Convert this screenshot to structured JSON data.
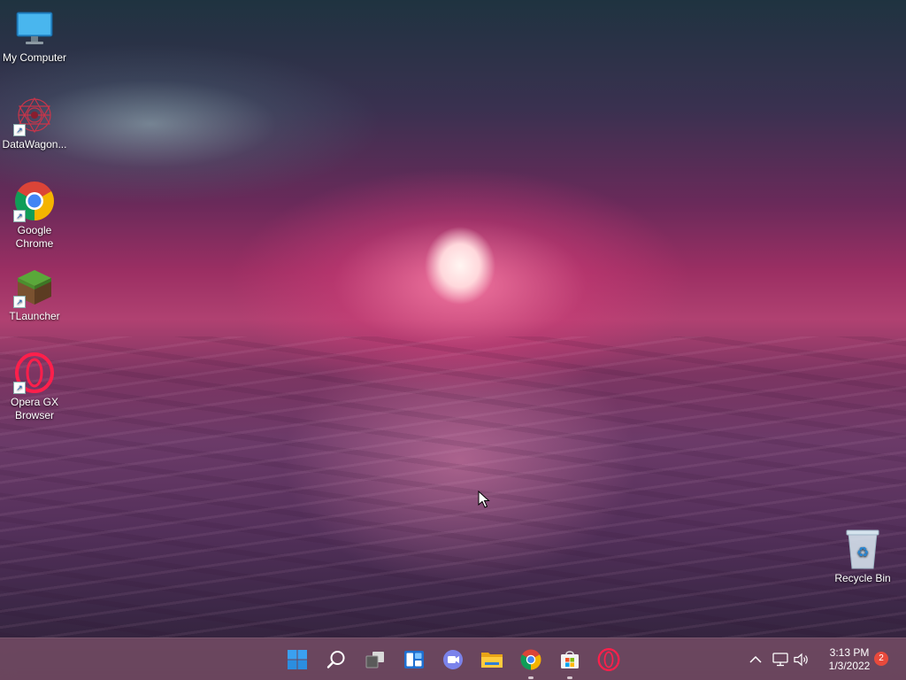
{
  "desktop_icons": [
    {
      "label": "My Computer",
      "icon": "monitor-icon",
      "shortcut": false
    },
    {
      "label": "DataWagon...",
      "icon": "datawagon-icon",
      "shortcut": true
    },
    {
      "label": "Google Chrome",
      "icon": "chrome-icon",
      "shortcut": true
    },
    {
      "label": "TLauncher",
      "icon": "grass-block-icon",
      "shortcut": true
    },
    {
      "label": "Opera GX Browser",
      "icon": "opera-gx-icon",
      "shortcut": true
    },
    {
      "label": "Recycle Bin",
      "icon": "recycle-bin-icon",
      "shortcut": false
    }
  ],
  "taskbar": {
    "apps": [
      {
        "name": "Start",
        "icon": "windows-start-icon"
      },
      {
        "name": "Search",
        "icon": "search-icon"
      },
      {
        "name": "Task View",
        "icon": "task-view-icon"
      },
      {
        "name": "Widgets",
        "icon": "widgets-icon"
      },
      {
        "name": "Chat",
        "icon": "teams-chat-icon"
      },
      {
        "name": "File Explorer",
        "icon": "folder-icon"
      },
      {
        "name": "Google Chrome",
        "icon": "chrome-icon",
        "running": true
      },
      {
        "name": "Microsoft Store",
        "icon": "store-icon",
        "running": true
      },
      {
        "name": "Opera GX",
        "icon": "opera-gx-icon"
      }
    ],
    "tray": {
      "icons": [
        "chevron-up-icon",
        "network-icon",
        "speaker-icon"
      ],
      "time": "3:13 PM",
      "date": "1/3/2022",
      "notification_count": "2"
    }
  },
  "colors": {
    "taskbar_bg": "#784e66",
    "accent_blue": "#0078d4",
    "badge_red": "#e84a3c"
  }
}
